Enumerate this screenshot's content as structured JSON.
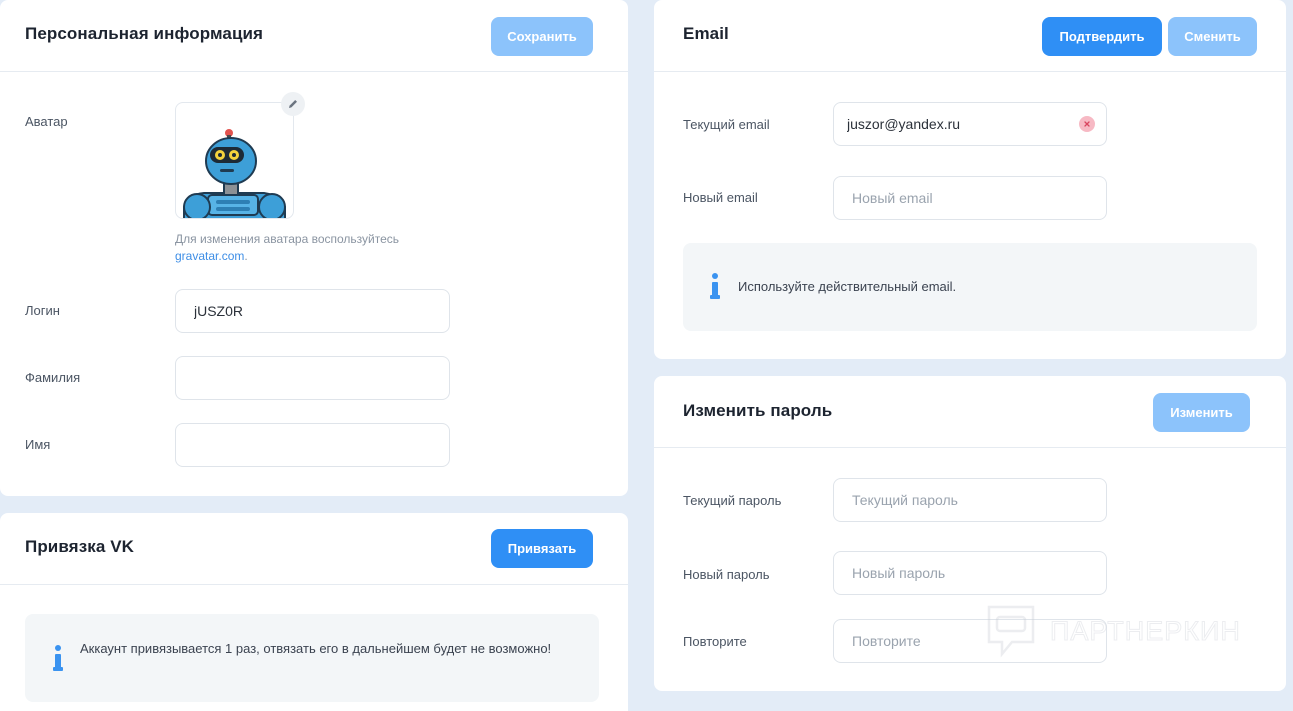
{
  "personal": {
    "title": "Персональная информация",
    "save_label": "Сохранить",
    "avatar_label": "Аватар",
    "avatar_hint": "Для изменения аватара воспользуйтесь",
    "avatar_link": "gravatar.com",
    "avatar_hint_end": ".",
    "login_label": "Логин",
    "login_value": "jUSZ0R",
    "lastname_label": "Фамилия",
    "lastname_value": "",
    "firstname_label": "Имя",
    "firstname_value": ""
  },
  "vk": {
    "title": "Привязка VK",
    "bind_label": "Привязать",
    "info_text": "Аккаунт привязывается 1 раз, отвязать его в дальнейшем будет не возможно!"
  },
  "email": {
    "title": "Email",
    "confirm_label": "Подтвердить",
    "change_label": "Сменить",
    "current_label": "Текущий email",
    "current_value": "juszor@yandex.ru",
    "new_label": "Новый email",
    "new_placeholder": "Новый email",
    "info_text": "Используйте действительный email."
  },
  "password": {
    "title": "Изменить пароль",
    "change_label": "Изменить",
    "current_label": "Текущий пароль",
    "current_placeholder": "Текущий пароль",
    "new_label": "Новый пароль",
    "new_placeholder": "Новый пароль",
    "repeat_label": "Повторите",
    "repeat_placeholder": "Повторите"
  },
  "watermark": {
    "text": "ПАРТНЕРКИН"
  },
  "colors": {
    "primary": "#2f8ff5",
    "primary_disabled": "#8cc3fb",
    "background": "#e3ecf7",
    "info_icon": "#3a93f0"
  },
  "icons": {
    "edit": "pencil-icon",
    "clear": "clear-x-icon",
    "info": "info-icon"
  }
}
